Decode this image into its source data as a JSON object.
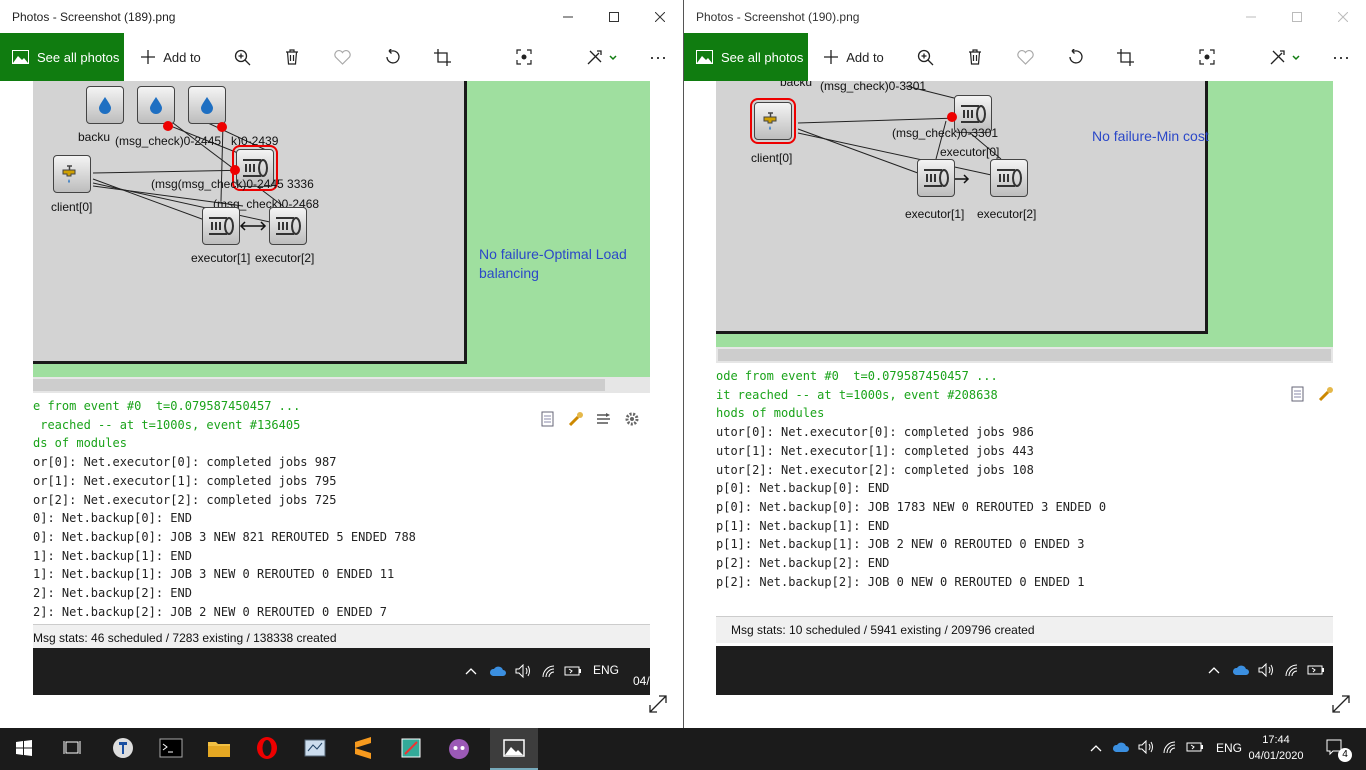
{
  "left_window": {
    "title": "Photos - Screenshot (189).png",
    "toolbar": {
      "see_all": "See all photos",
      "add_to": "Add to"
    },
    "sim": {
      "annotation": "No failure-Optimal Load balancing",
      "labels": {
        "backup": "backu",
        "msg1": "(msg_check)0-2445",
        "msg2": "k)0-2439",
        "msg3": "(msg(msg_check)0-2445 3336",
        "msg4": "(msg_check)0-2468",
        "client": "client[0]",
        "exec1": "executor[1]",
        "exec2": "executor[2]"
      }
    },
    "console": {
      "lines_green": [
        "e from event #0  t=0.079587450457 ...",
        " reached -- at t=1000s, event #136405",
        "ds of modules"
      ],
      "lines": [
        "or[0]: Net.executor[0]: completed jobs 987",
        "or[1]: Net.executor[1]: completed jobs 795",
        "or[2]: Net.executor[2]: completed jobs 725",
        "0]: Net.backup[0]: END",
        "0]: Net.backup[0]: JOB 3 NEW 821 REROUTED 5 ENDED 788",
        "1]: Net.backup[1]: END",
        "1]: Net.backup[1]: JOB 3 NEW 0 REROUTED 0 ENDED 11",
        "2]: Net.backup[2]: END",
        "2]: Net.backup[2]: JOB 2 NEW 0 REROUTED 0 ENDED 7"
      ]
    },
    "status": "Msg stats: 46 scheduled / 7283 existing / 138338 created",
    "inner_taskbar": {
      "lang": "ENG",
      "clock": "04/"
    }
  },
  "right_window": {
    "title": "Photos - Screenshot (190).png",
    "toolbar": {
      "see_all": "See all photos",
      "add_to": "Add to"
    },
    "sim": {
      "annotation": "No failure-Min cost",
      "labels": {
        "backup": "backu",
        "msg1": "(msg_check)0-3301",
        "msg2": "(msg_check)0-3301",
        "exec0": "executor[0]",
        "client": "client[0]",
        "exec1": "executor[1]",
        "exec2": "executor[2]"
      }
    },
    "console": {
      "lines_green": [
        "ode from event #0  t=0.079587450457 ...",
        "it reached -- at t=1000s, event #208638",
        "hods of modules"
      ],
      "lines": [
        "utor[0]: Net.executor[0]: completed jobs 986",
        "utor[1]: Net.executor[1]: completed jobs 443",
        "utor[2]: Net.executor[2]: completed jobs 108",
        "p[0]: Net.backup[0]: END",
        "p[0]: Net.backup[0]: JOB 1783 NEW 0 REROUTED 3 ENDED 0",
        "p[1]: Net.backup[1]: END",
        "p[1]: Net.backup[1]: JOB 2 NEW 0 REROUTED 0 ENDED 3",
        "p[2]: Net.backup[2]: END",
        "p[2]: Net.backup[2]: JOB 0 NEW 0 REROUTED 0 ENDED 1"
      ]
    },
    "status": "Msg stats: 10 scheduled / 5941 existing / 209796 created",
    "inner_taskbar": {
      "lang": "ENG"
    }
  },
  "taskbar": {
    "lang": "ENG",
    "time": "17:44",
    "date": "04/01/2020",
    "notifications": "4"
  }
}
